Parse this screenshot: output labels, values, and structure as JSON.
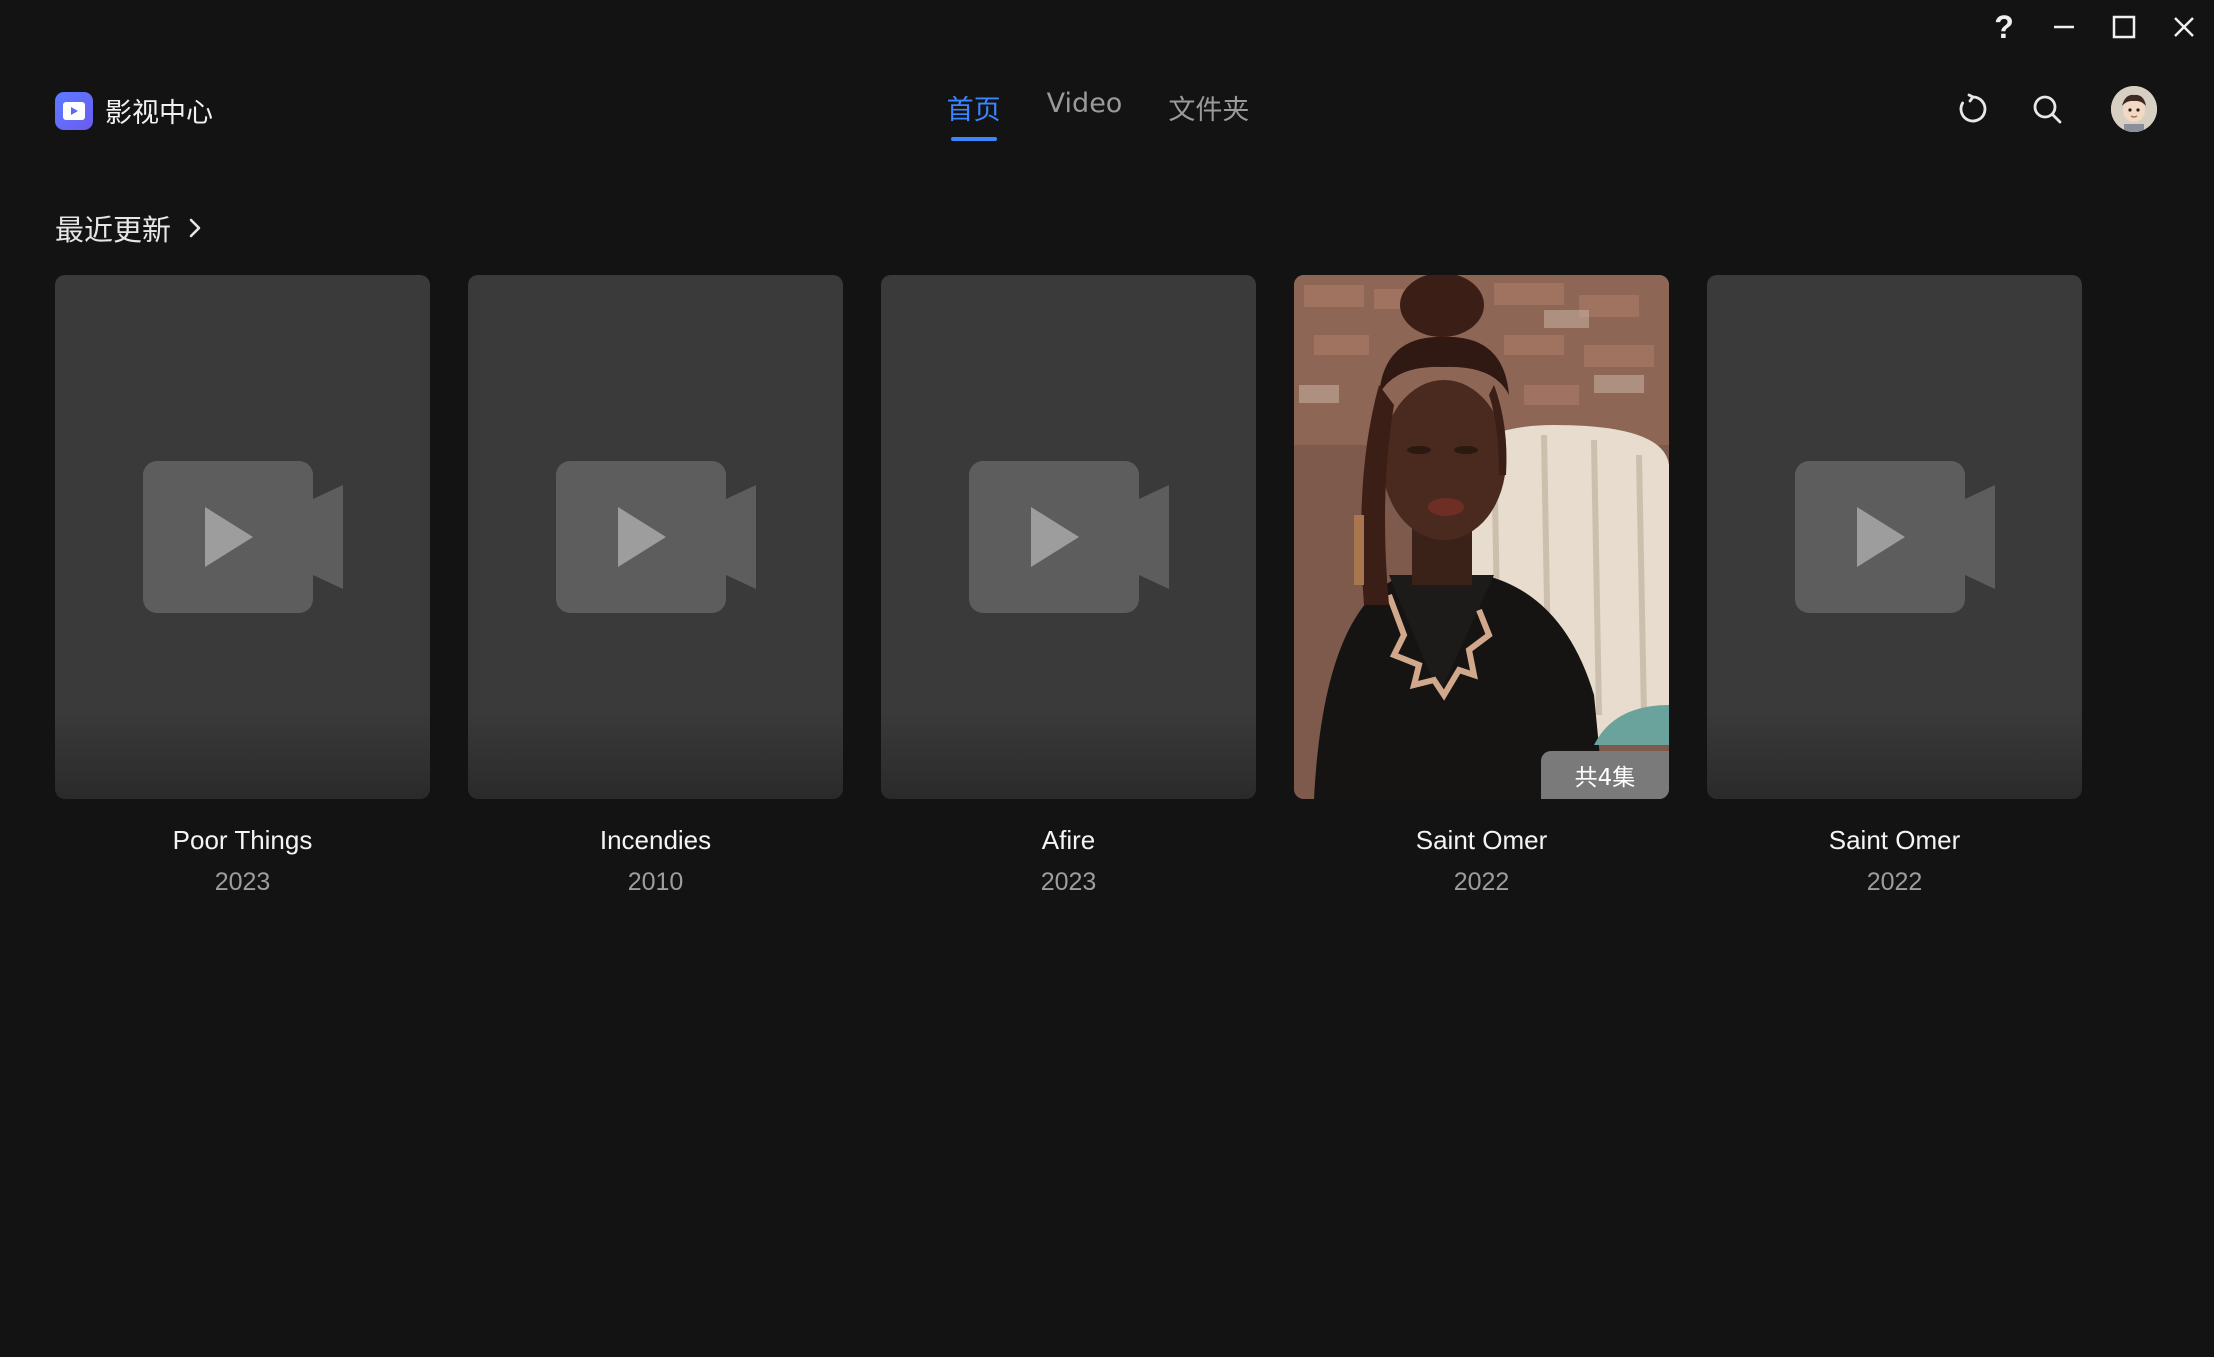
{
  "window_controls": {
    "help_label": "?",
    "minimize_icon": "minimize-icon",
    "maximize_icon": "maximize-icon",
    "close_icon": "close-icon"
  },
  "header": {
    "app_title": "影视中心",
    "tabs": [
      {
        "label": "首页",
        "active": true
      },
      {
        "label": "Video",
        "active": false
      },
      {
        "label": "文件夹",
        "active": false
      }
    ],
    "tools": [
      "refresh-icon",
      "search-icon"
    ],
    "accent_color": "#3a86ff"
  },
  "section": {
    "title": "最近更新"
  },
  "cards": [
    {
      "title": "Poor Things",
      "year": "2023",
      "poster": "placeholder"
    },
    {
      "title": "Incendies",
      "year": "2010",
      "poster": "placeholder"
    },
    {
      "title": "Afire",
      "year": "2023",
      "poster": "placeholder"
    },
    {
      "title": "Saint Omer",
      "year": "2022",
      "poster": "photo",
      "badge": "共4集"
    },
    {
      "title": "Saint Omer",
      "year": "2022",
      "poster": "placeholder"
    }
  ]
}
